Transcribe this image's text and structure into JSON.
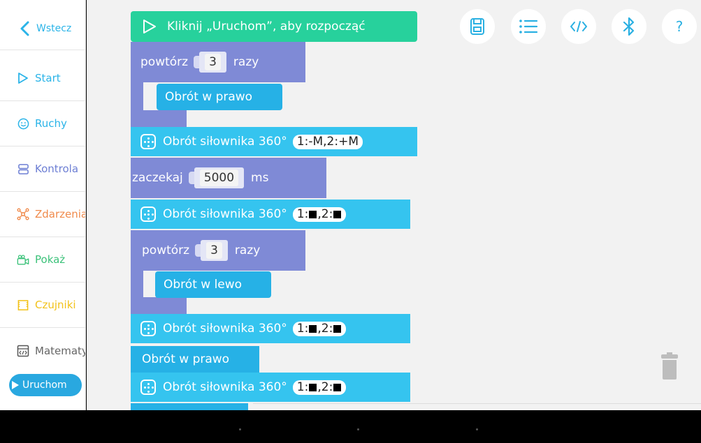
{
  "sidebar": {
    "back": "Wstecz",
    "items": [
      {
        "label": "Start",
        "color": "#2bb4e8"
      },
      {
        "label": "Ruchy",
        "color": "#2bb4e8"
      },
      {
        "label": "Kontrola",
        "color": "#6d7fd4"
      },
      {
        "label": "Zdarzenia",
        "color": "#f08a4b"
      },
      {
        "label": "Pokaż",
        "color": "#3cc27a"
      },
      {
        "label": "Czujniki",
        "color": "#f2c21a"
      },
      {
        "label": "Matematyka",
        "color": "#666666"
      }
    ],
    "run": "Uruchom"
  },
  "workspace": {
    "start_block": "Kliknij „Uruchom”, aby rozpocząć",
    "repeat1": {
      "prefix": "powtórz",
      "count": "3",
      "suffix": "razy",
      "inner": "Obrót w prawo"
    },
    "servo1": {
      "label": "Obrót siłownika 360°",
      "value": "1:-M,2:+M"
    },
    "wait": {
      "prefix": "zaczekaj",
      "value": "5000",
      "suffix": "ms"
    },
    "servo2": {
      "label": "Obrót siłownika 360°",
      "value_a": "1:",
      "value_b": ",2:"
    },
    "repeat2": {
      "prefix": "powtórz",
      "count": "3",
      "suffix": "razy",
      "inner": "Obrót w lewo"
    },
    "servo3": {
      "label": "Obrót siłownika 360°",
      "value_a": "1:",
      "value_b": ",2:"
    },
    "turn_right": "Obrót w prawo",
    "servo4": {
      "label": "Obrót siłownika 360°",
      "value_a": "1:",
      "value_b": ",2:"
    }
  },
  "toolbar": {
    "help": "?",
    "icons": [
      "save-icon",
      "list-icon",
      "code-icon",
      "bluetooth-icon",
      "help-icon"
    ]
  },
  "colors": {
    "accent": "#29a8e0",
    "purple_block": "#7f8ad6",
    "cyan_block": "#35c4ef",
    "green_block": "#27d19c"
  }
}
